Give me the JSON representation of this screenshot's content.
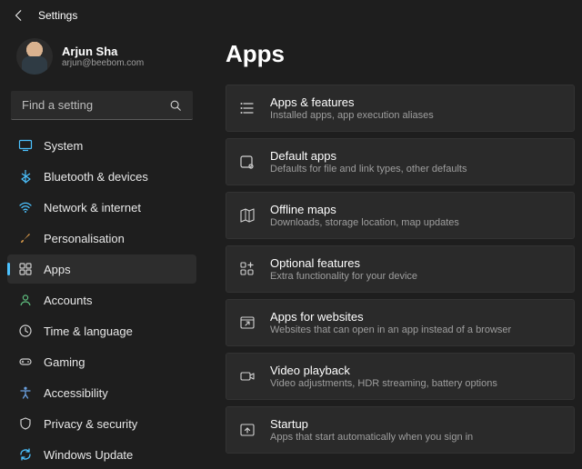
{
  "window": {
    "title": "Settings"
  },
  "user": {
    "name": "Arjun Sha",
    "email": "arjun@beebom.com"
  },
  "search": {
    "placeholder": "Find a setting"
  },
  "sidebar": {
    "items": [
      {
        "label": "System"
      },
      {
        "label": "Bluetooth & devices"
      },
      {
        "label": "Network & internet"
      },
      {
        "label": "Personalisation"
      },
      {
        "label": "Apps"
      },
      {
        "label": "Accounts"
      },
      {
        "label": "Time & language"
      },
      {
        "label": "Gaming"
      },
      {
        "label": "Accessibility"
      },
      {
        "label": "Privacy & security"
      },
      {
        "label": "Windows Update"
      }
    ],
    "active_index": 4
  },
  "page": {
    "title": "Apps",
    "items": [
      {
        "title": "Apps & features",
        "desc": "Installed apps, app execution aliases"
      },
      {
        "title": "Default apps",
        "desc": "Defaults for file and link types, other defaults"
      },
      {
        "title": "Offline maps",
        "desc": "Downloads, storage location, map updates"
      },
      {
        "title": "Optional features",
        "desc": "Extra functionality for your device"
      },
      {
        "title": "Apps for websites",
        "desc": "Websites that can open in an app instead of a browser"
      },
      {
        "title": "Video playback",
        "desc": "Video adjustments, HDR streaming, battery options"
      },
      {
        "title": "Startup",
        "desc": "Apps that start automatically when you sign in"
      }
    ]
  }
}
